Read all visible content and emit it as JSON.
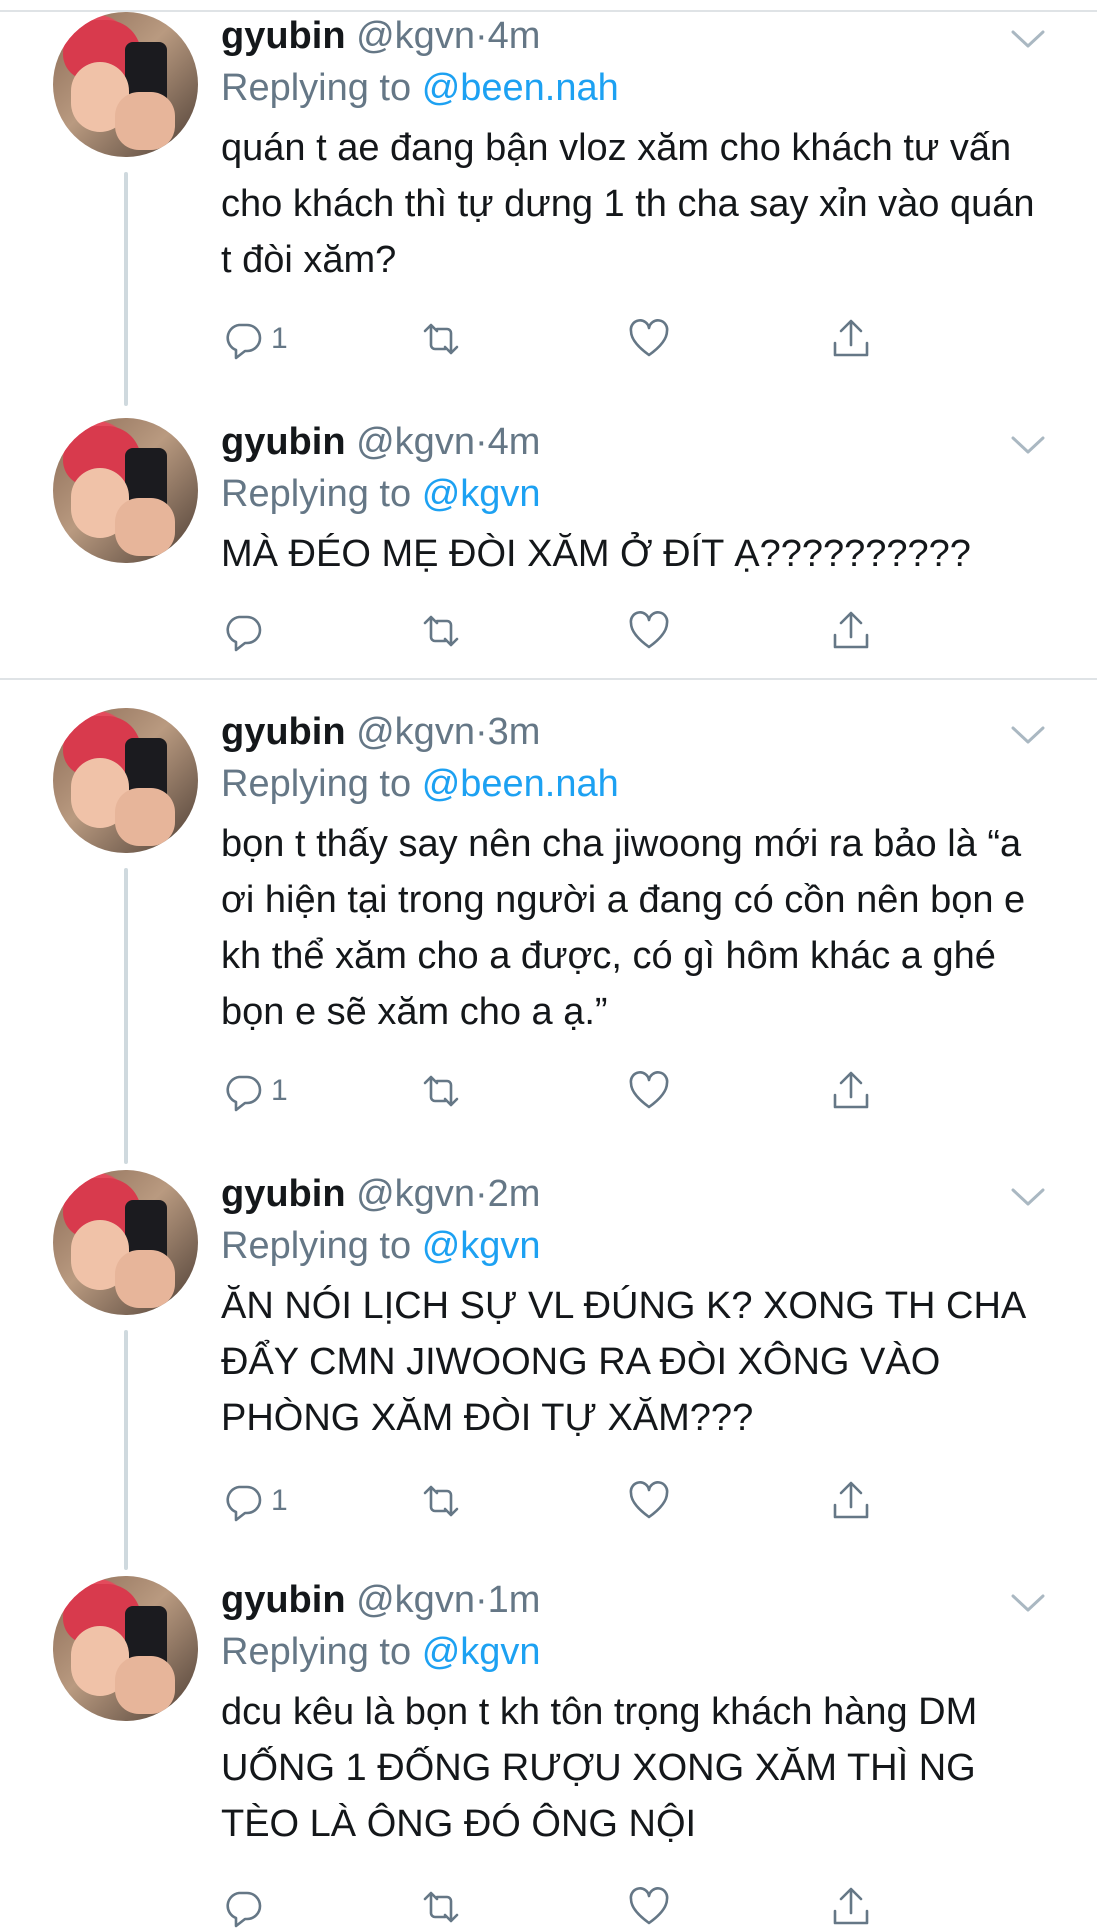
{
  "tweets": [
    {
      "name": "gyubin",
      "handle": "@kgvn",
      "dot": "·",
      "time": "4m",
      "reply_prefix": "Replying to",
      "reply_to": "@been.nah",
      "text": "quán t ae đang bận vloz xăm cho khách tư vấn cho khách thì tự dưng 1 th cha say xỉn vào quán t đòi xăm?",
      "reply_count": "1"
    },
    {
      "name": "gyubin",
      "handle": "@kgvn",
      "dot": "·",
      "time": "4m",
      "reply_prefix": "Replying to",
      "reply_to": "@kgvn",
      "text": "MÀ ĐÉO MẸ ĐÒI XĂM Ở ĐÍT Ạ??????????",
      "reply_count": ""
    },
    {
      "name": "gyubin",
      "handle": "@kgvn",
      "dot": "·",
      "time": "3m",
      "reply_prefix": "Replying to",
      "reply_to": "@been.nah",
      "text": "bọn t thấy say nên cha jiwoong mới ra bảo là “a ơi hiện tại trong người a đang có cồn nên bọn e kh thể xăm cho a được, có gì hôm khác a ghé bọn e sẽ xăm cho a ạ.”",
      "reply_count": "1"
    },
    {
      "name": "gyubin",
      "handle": "@kgvn",
      "dot": "·",
      "time": "2m",
      "reply_prefix": "Replying to",
      "reply_to": "@kgvn",
      "text": "ĂN NÓI LỊCH SỰ VL ĐÚNG K? XONG TH CHA ĐẨY CMN JIWOONG RA ĐÒI XÔNG VÀO PHÒNG XĂM ĐÒI TỰ XĂM???",
      "reply_count": "1"
    },
    {
      "name": "gyubin",
      "handle": "@kgvn",
      "dot": "·",
      "time": "1m",
      "reply_prefix": "Replying to",
      "reply_to": "@kgvn",
      "text": "dcu kêu là bọn t kh tôn trọng khách hàng DM UỐNG 1 ĐỐNG RƯỢU XONG XĂM THÌ NG TÈO LÀ ÔNG ĐÓ ÔNG NỘI",
      "reply_count": ""
    }
  ],
  "colors": {
    "text": "#14171a",
    "secondary": "#657786",
    "link": "#1da1f2",
    "divider": "#dfe3e6",
    "thread": "#cfd9de"
  },
  "icons": [
    "reply-icon",
    "retweet-icon",
    "like-icon",
    "share-icon",
    "chevron-down-icon"
  ]
}
